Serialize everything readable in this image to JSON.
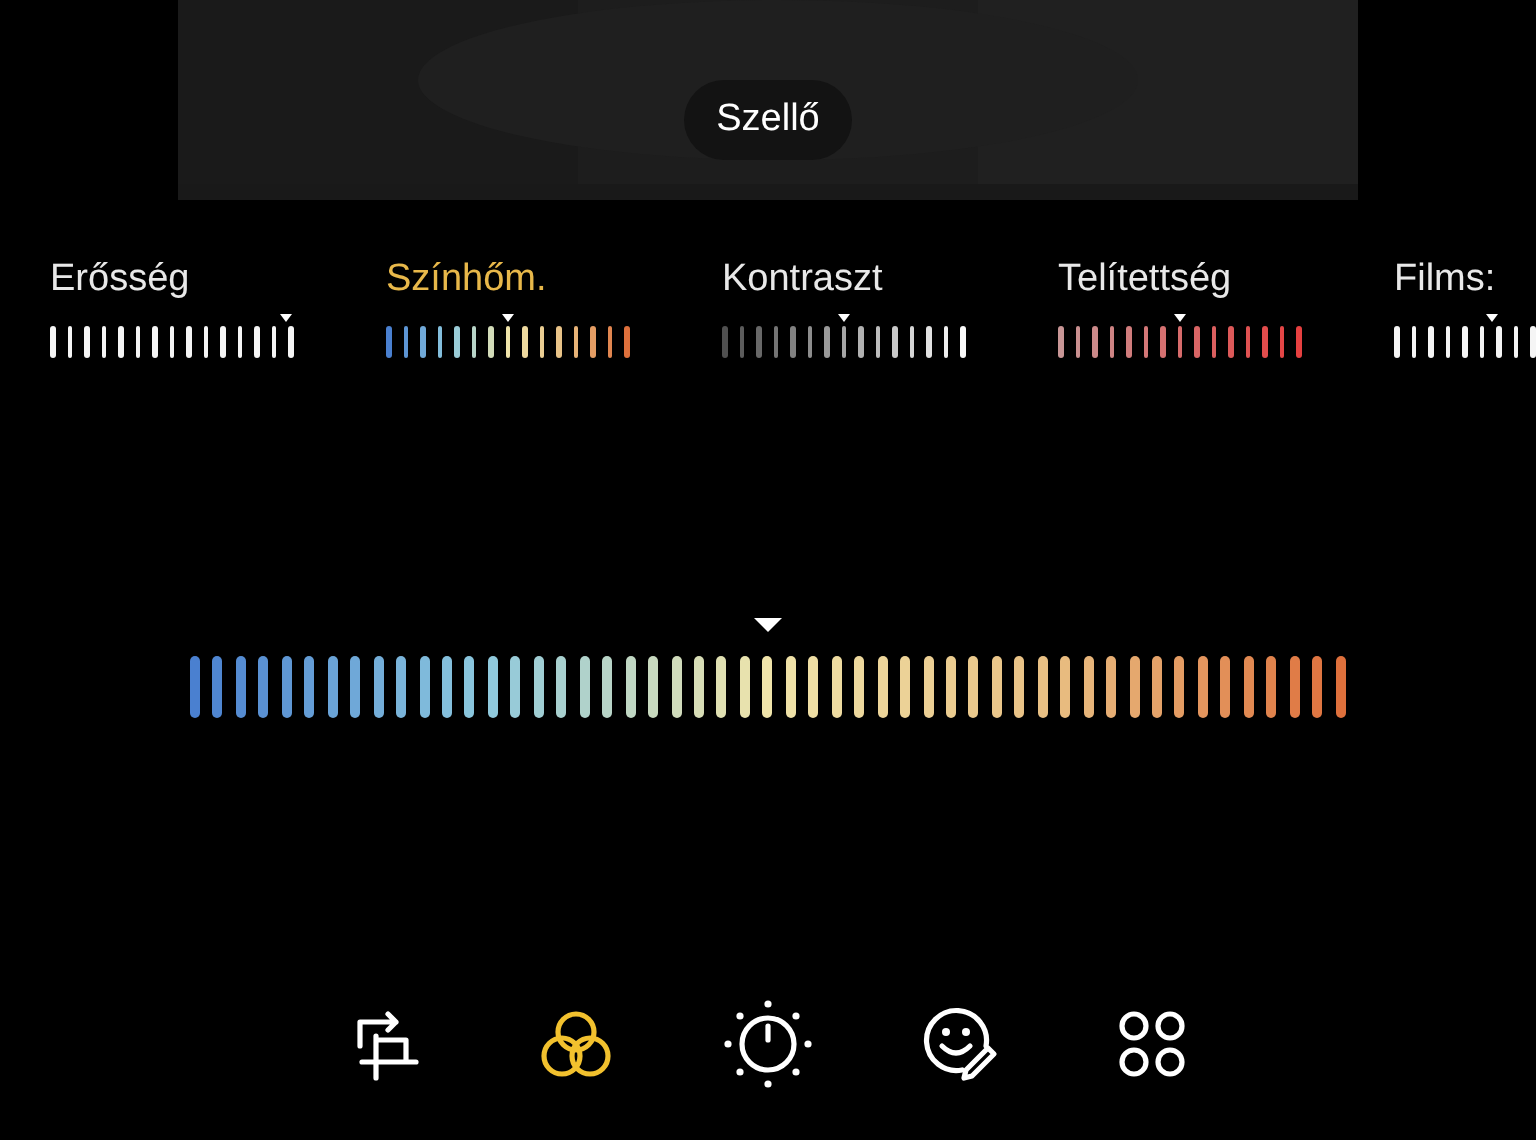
{
  "photo": {
    "kind": "picture",
    "filter_label": "Szellő"
  },
  "adjustments": [
    {
      "label": "Erősség",
      "kind": "intensity",
      "selected": false,
      "level": 0.97
    },
    {
      "label": "Színhőm.",
      "kind": "temperature",
      "selected": true,
      "level": 0.5
    },
    {
      "label": "Kontraszt",
      "kind": "contrast",
      "selected": false,
      "level": 0.5
    },
    {
      "label": "Telítettség",
      "kind": "saturation",
      "selected": false,
      "level": 0.5
    },
    {
      "label": "Films:",
      "kind": "film",
      "selected": false,
      "level": 0.4
    }
  ],
  "main_slider": {
    "kind": "temperature",
    "level": 0.5
  },
  "toolbar": [
    {
      "kind": "crop",
      "selected": false
    },
    {
      "kind": "filters",
      "selected": true
    },
    {
      "kind": "adjust",
      "selected": false
    },
    {
      "kind": "sticker",
      "selected": false
    },
    {
      "kind": "more",
      "selected": false
    }
  ]
}
